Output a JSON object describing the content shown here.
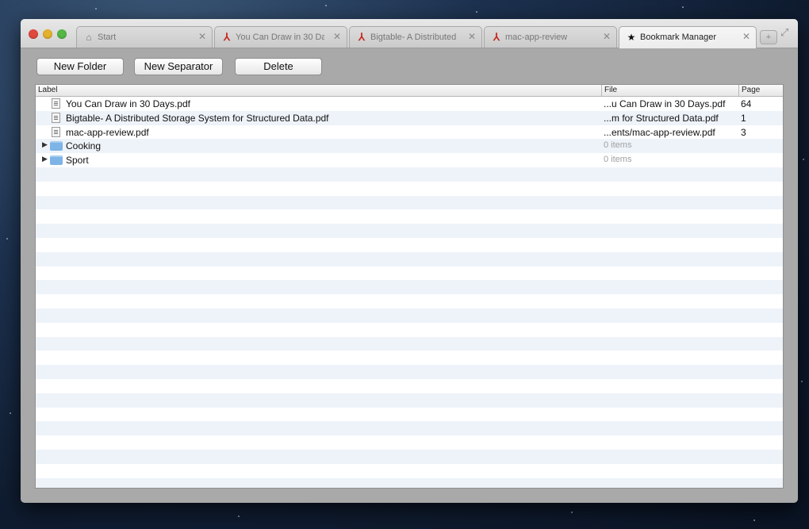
{
  "window": {
    "tabs": [
      {
        "label": "Start",
        "icon": "home-icon",
        "active": false
      },
      {
        "label": "You Can Draw in 30 Da",
        "icon": "pdf-icon",
        "active": false
      },
      {
        "label": "Bigtable- A Distributed",
        "icon": "pdf-icon",
        "active": false
      },
      {
        "label": "mac-app-review",
        "icon": "pdf-icon",
        "active": false
      },
      {
        "label": "Bookmark Manager",
        "icon": "star-icon",
        "active": true
      }
    ],
    "close_glyph": "✕"
  },
  "toolbar": {
    "new_folder_label": "New Folder",
    "new_separator_label": "New Separator",
    "delete_label": "Delete"
  },
  "table": {
    "columns": {
      "label": "Label",
      "file": "File",
      "page": "Page"
    },
    "rows": [
      {
        "type": "file",
        "label": "You Can Draw in 30 Days.pdf",
        "file": "...u Can Draw in 30 Days.pdf",
        "page": "64"
      },
      {
        "type": "file",
        "label": "Bigtable- A Distributed Storage System for Structured Data.pdf",
        "file": "...m for Structured Data.pdf",
        "page": "1"
      },
      {
        "type": "file",
        "label": "mac-app-review.pdf",
        "file": "...ents/mac-app-review.pdf",
        "page": "3"
      },
      {
        "type": "folder",
        "label": "Cooking",
        "file": "0 items",
        "page": ""
      },
      {
        "type": "folder",
        "label": "Sport",
        "file": "0 items",
        "page": ""
      }
    ]
  },
  "colors": {
    "close": "#e0493e",
    "minimize": "#e3b12c",
    "maximize": "#55b745",
    "pdf": "#c8281e",
    "row_stripe": "#eef3fa"
  }
}
